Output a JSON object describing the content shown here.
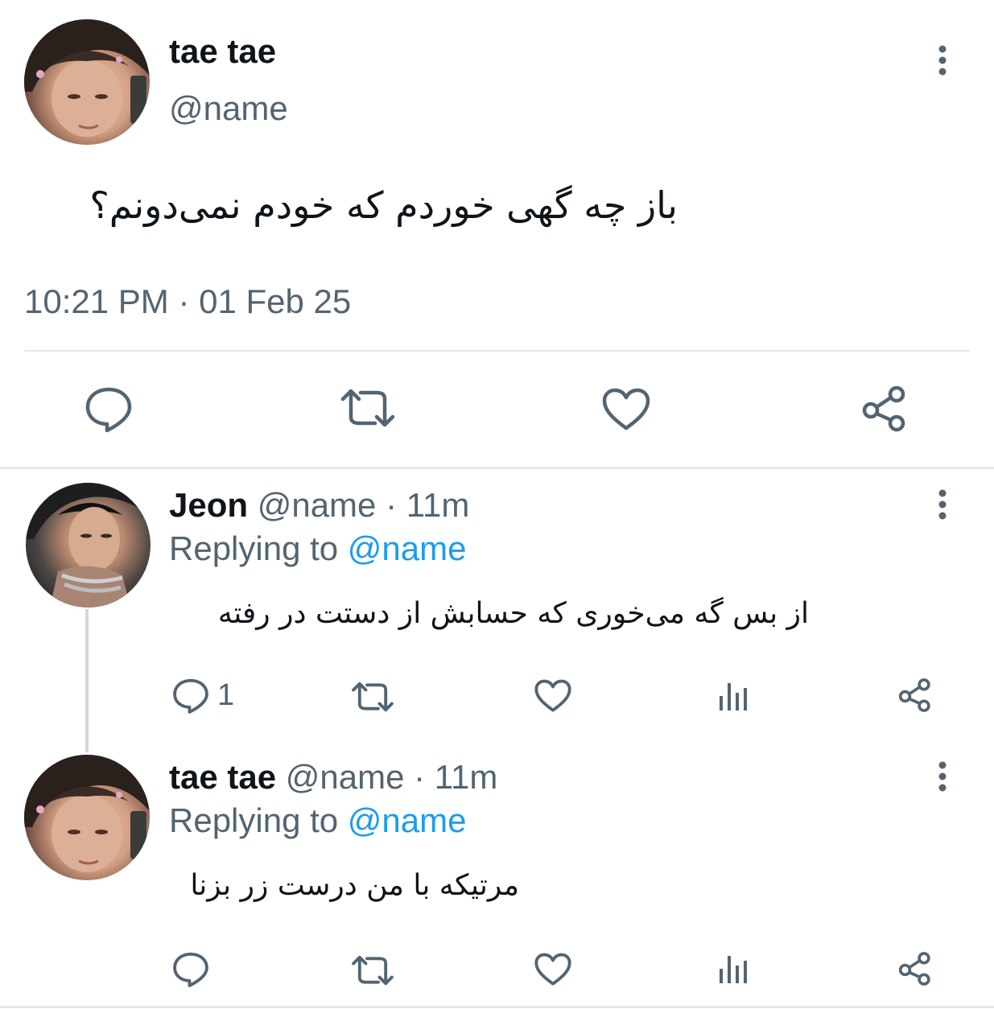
{
  "main_tweet": {
    "display_name": "tae tae",
    "handle": "@name",
    "text": "باز چه گهی خوردم که خودم نمی‌دونم؟",
    "timestamp": "10:21 PM · 01 Feb 25",
    "avatar_icon": "avatar-image",
    "actions": [
      "reply-icon",
      "retweet-icon",
      "like-icon",
      "share-icon"
    ]
  },
  "replies": [
    {
      "display_name": "Jeon",
      "handle": "@name",
      "separator": "·",
      "time": "11m",
      "replying_prefix": "Replying to",
      "replying_handle": "@name",
      "text": "از بس گه می‌خوری که حسابش از دستت در رفته",
      "reply_count": "1"
    },
    {
      "display_name": "tae tae",
      "handle": "@name",
      "separator": "·",
      "time": "11m",
      "replying_prefix": "Replying to",
      "replying_handle": "@name",
      "text": "مرتیکه با من درست زر بزنا",
      "reply_count": ""
    }
  ],
  "colors": {
    "text": "#0f1419",
    "muted": "#536471",
    "link": "#1d9bf0",
    "divider": "#e6e9eb"
  }
}
